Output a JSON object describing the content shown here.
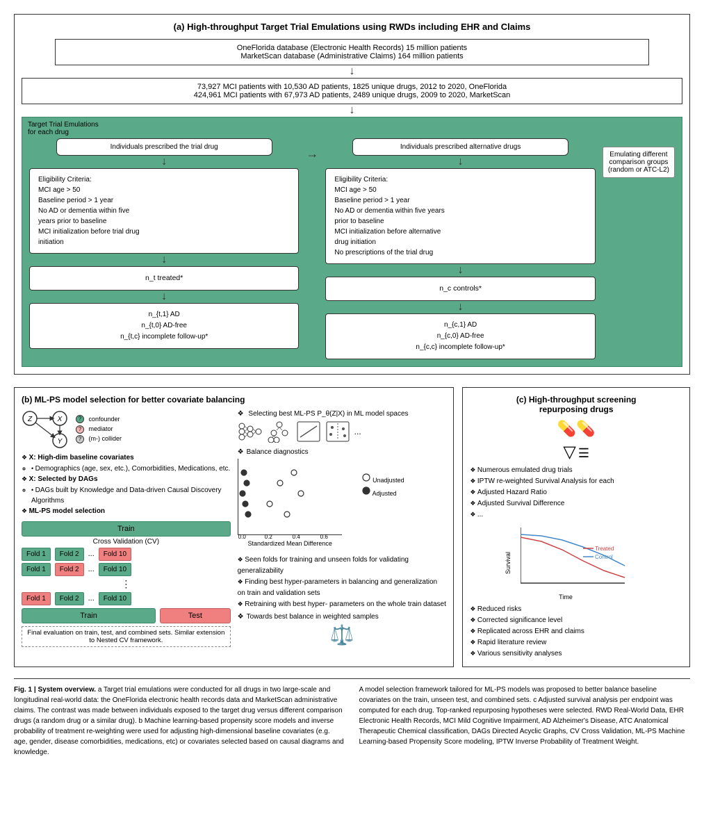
{
  "sectionA": {
    "title": "(a) High-throughput Target Trial Emulations using RWDs including EHR and Claims",
    "db_box": "OneFlorida database (Electronic Health Records) 15 million patients\nMarketScan database (Administrative Claims) 164 million patients",
    "mci_box": "73,927 MCI patients with 10,530 AD patients, 1825 unique drugs, 2012 to 2020, OneFlorida\n424,961 MCI patients with 67,973 AD patients, 2489 unique drugs, 2009 to 2020, MarketScan",
    "green_label": "Target Trial Emulations\nfor each drug",
    "treated_label": "Individuals prescribed the trial drug",
    "alternative_label": "Individuals prescribed alternative\ndrugs",
    "comparison_label": "Emulating different\ncomparison groups\n(random or ATC-L2)",
    "eligibility_left": "Eligibility Criteria:\nMCI age > 50\nBaseline period > 1 year\nNo AD or dementia within five\nyears prior to baseline\nMCI initialization before trial drug\ninitiation",
    "eligibility_right": "Eligibility Criteria:\nMCI age > 50\nBaseline period > 1 year\nNo AD or dementia within five years\nprior to baseline\nMCI initialization before alternative\ndrug initiation\nNo prescriptions of the trial drug",
    "treated_count": "n_t treated*",
    "controls_count": "n_c controls*",
    "outcome_left": "n_{t,1} AD\nn_{t,0} AD-free\nn_{t,c} incomplete follow-up*",
    "outcome_right": "n_{c,1} AD\nn_{c,0} AD-free\nn_{c,c} incomplete follow-up*"
  },
  "sectionB": {
    "title": "(b) ML-PS model selection for better covariate balancing",
    "bullet1": "X: High-dim baseline covariates",
    "bullet1_sub1": "Demographics (age, sex, etc.), Comorbidities, Medications, etc.",
    "bullet2": "X: Selected by DAGs",
    "bullet2_sub1": "DAGs built by Knowledge and Data-driven Causal Discovery Algorithms",
    "bullet3": "ML-PS model selection",
    "dag_nodes": [
      "X",
      "Z",
      "Y"
    ],
    "legend_items": [
      "confounder",
      "mediator",
      "(m-) collider"
    ],
    "train_label": "Train",
    "test_label": "Test",
    "cv_label": "Cross Validation (CV)",
    "fold_labels": [
      "Fold 1",
      "Fold 2",
      "...",
      "Fold 10"
    ],
    "cv_bullets": [
      "Seen folds for training and unseen folds for validating generalizability",
      "Finding best hyper-parameters in balancing and generalization on train and validation sets",
      "Retraining with best hyper- parameters on the whole train dataset"
    ],
    "select_label": "Selecting best ML-PS P_θ(Z|X) in ML\nmodel spaces",
    "balance_label": "Balance diagnostics",
    "towards_label": "Towards best balance in\nweighted samples",
    "final_eval": "Final evaluation on train, test, and combined sets.\nSimilar extension to Nested CV framework.",
    "x_axis_label": "Standardized Mean Difference",
    "legend_unadjusted": "Unadjusted",
    "legend_adjusted": "Adjusted"
  },
  "sectionC": {
    "title": "(c) High-throughput screening\nrepurposing drugs",
    "bullets": [
      "Numerous emulated drug trials",
      "IPTW re-weighted Survival Analysis for each",
      "Adjusted Hazard Ratio",
      "Adjusted Survival Difference",
      "..."
    ],
    "survival_labels": [
      "Survival",
      "Time"
    ],
    "treated_line": "Treated",
    "control_line": "Control",
    "bottom_bullets": [
      "Reduced risks",
      "Corrected significance level",
      "Replicated across EHR and claims",
      "Rapid literature review",
      "Various sensitivity analyses"
    ]
  },
  "caption": {
    "fig_label": "Fig. 1 | System overview.",
    "left_text": "a Target trial emulations were conducted for all drugs in two large-scale and longitudinal real-world data: the OneFlorida electronic health records data and MarketScan administrative claims. The contrast was made between individuals exposed to the target drug versus different comparison drugs (a random drug or a similar drug). b Machine learning-based propensity score models and inverse probability of treatment re-weighting were used for adjusting high-dimensional baseline covariates (e.g. age, gender, disease comorbidities, medications, etc) or covariates selected based on causal diagrams and knowledge.",
    "right_text": "A model selection framework tailored for ML-PS models was proposed to better balance baseline covariates on the train, unseen test, and combined sets. c Adjusted survival analysis per endpoint was computed for each drug. Top-ranked repurposing hypotheses were selected. RWD Real-World Data, EHR Electronic Health Records, MCI Mild Cognitive Impairment, AD Alzheimer's Disease, ATC Anatomical Therapeutic Chemical classification, DAGs Directed Acyclic Graphs, CV Cross Validation, ML-PS Machine Learning-based Propensity Score modeling, IPTW Inverse Probability of Treatment Weight."
  }
}
